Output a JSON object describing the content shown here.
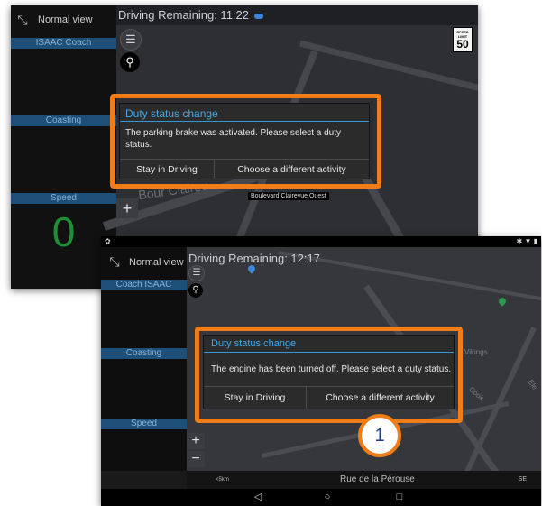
{
  "screenshot_1": {
    "normal_view_label": "Normal view",
    "coach_label": "ISAAC Coach",
    "coasting_label": "Coasting",
    "speed_label": "Speed",
    "speed_value": "0",
    "title": "Driving Remaining: 11:22",
    "speed_limit": {
      "label": "SPEED LIMIT",
      "value": "50"
    },
    "street_partial": "Bour Clairev",
    "street_label": "Boulevard Clairevue Ouest",
    "zoom_in": "+",
    "dialog": {
      "title": "Duty status change",
      "message": "The parking brake was activated. Please select a duty status.",
      "stay_button": "Stay in Driving",
      "choose_button": "Choose a different activity"
    }
  },
  "screenshot_2": {
    "status_left": "✿",
    "status_right": "✱ ▼ ▮",
    "normal_view_label": "Normal view",
    "coach_label": "Coach ISAAC",
    "coasting_label": "Coasting",
    "speed_label": "Speed",
    "title": "Driving Remaining: 12:17",
    "map_label_vikings": "Vikings",
    "map_label_cook": "Cook",
    "map_label_el": "Ele",
    "zoom_in": "+",
    "zoom_out": "−",
    "bottom_left": "<5km",
    "street_name": "Rue de la Pérouse",
    "bottom_right": "SE",
    "dialog": {
      "title": "Duty status change",
      "message": "The engine has been turned off. Please select a duty status.",
      "stay_button": "Stay in Driving",
      "choose_button": "Choose a different activity"
    },
    "nav": {
      "back": "◁",
      "home": "○",
      "recents": "□"
    }
  },
  "callout_number": "1",
  "colors": {
    "highlight": "#f07d17",
    "accent_blue": "#44a9e8",
    "speed_green": "#1e8f34"
  }
}
